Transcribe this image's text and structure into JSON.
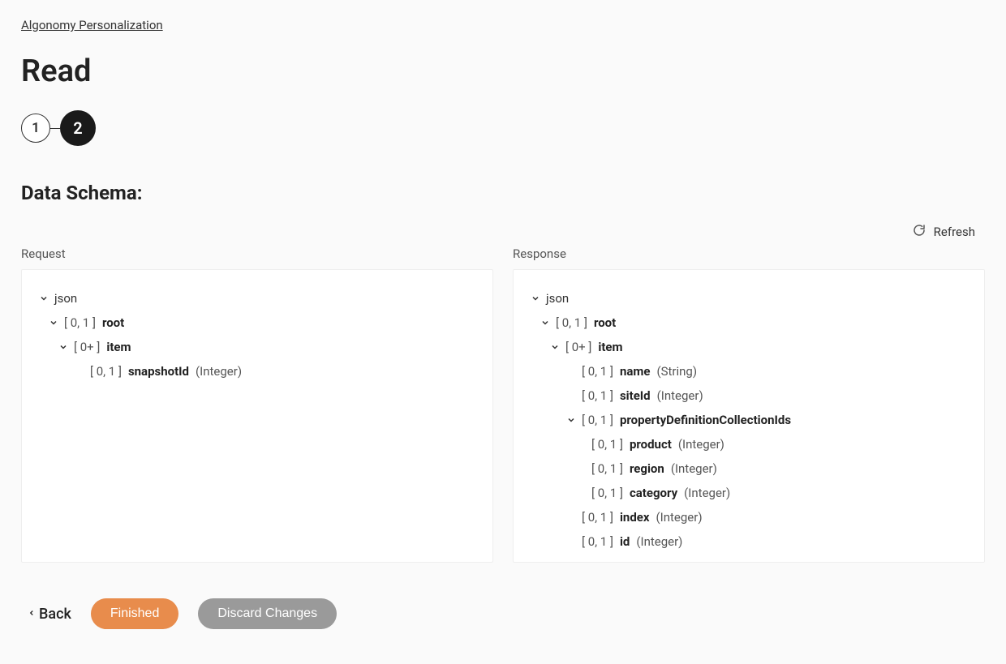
{
  "breadcrumb": "Algonomy Personalization",
  "pageTitle": "Read",
  "stepper": {
    "step1": "1",
    "step2": "2"
  },
  "sectionTitle": "Data Schema:",
  "refreshLabel": "Refresh",
  "requestLabel": "Request",
  "responseLabel": "Response",
  "requestTree": {
    "jsonLabel": "json",
    "root": {
      "card": "[ 0, 1 ]",
      "name": "root"
    },
    "item": {
      "card": "[ 0+ ]",
      "name": "item"
    },
    "snapshotId": {
      "card": "[ 0, 1 ]",
      "name": "snapshotId",
      "type": "(Integer)"
    }
  },
  "responseTree": {
    "jsonLabel": "json",
    "root": {
      "card": "[ 0, 1 ]",
      "name": "root"
    },
    "item": {
      "card": "[ 0+ ]",
      "name": "item"
    },
    "nameField": {
      "card": "[ 0, 1 ]",
      "name": "name",
      "type": "(String)"
    },
    "siteId": {
      "card": "[ 0, 1 ]",
      "name": "siteId",
      "type": "(Integer)"
    },
    "propDef": {
      "card": "[ 0, 1 ]",
      "name": "propertyDefinitionCollectionIds"
    },
    "product": {
      "card": "[ 0, 1 ]",
      "name": "product",
      "type": "(Integer)"
    },
    "region": {
      "card": "[ 0, 1 ]",
      "name": "region",
      "type": "(Integer)"
    },
    "category": {
      "card": "[ 0, 1 ]",
      "name": "category",
      "type": "(Integer)"
    },
    "index": {
      "card": "[ 0, 1 ]",
      "name": "index",
      "type": "(Integer)"
    },
    "id": {
      "card": "[ 0, 1 ]",
      "name": "id",
      "type": "(Integer)"
    }
  },
  "buttons": {
    "back": "Back",
    "finished": "Finished",
    "discard": "Discard Changes"
  }
}
